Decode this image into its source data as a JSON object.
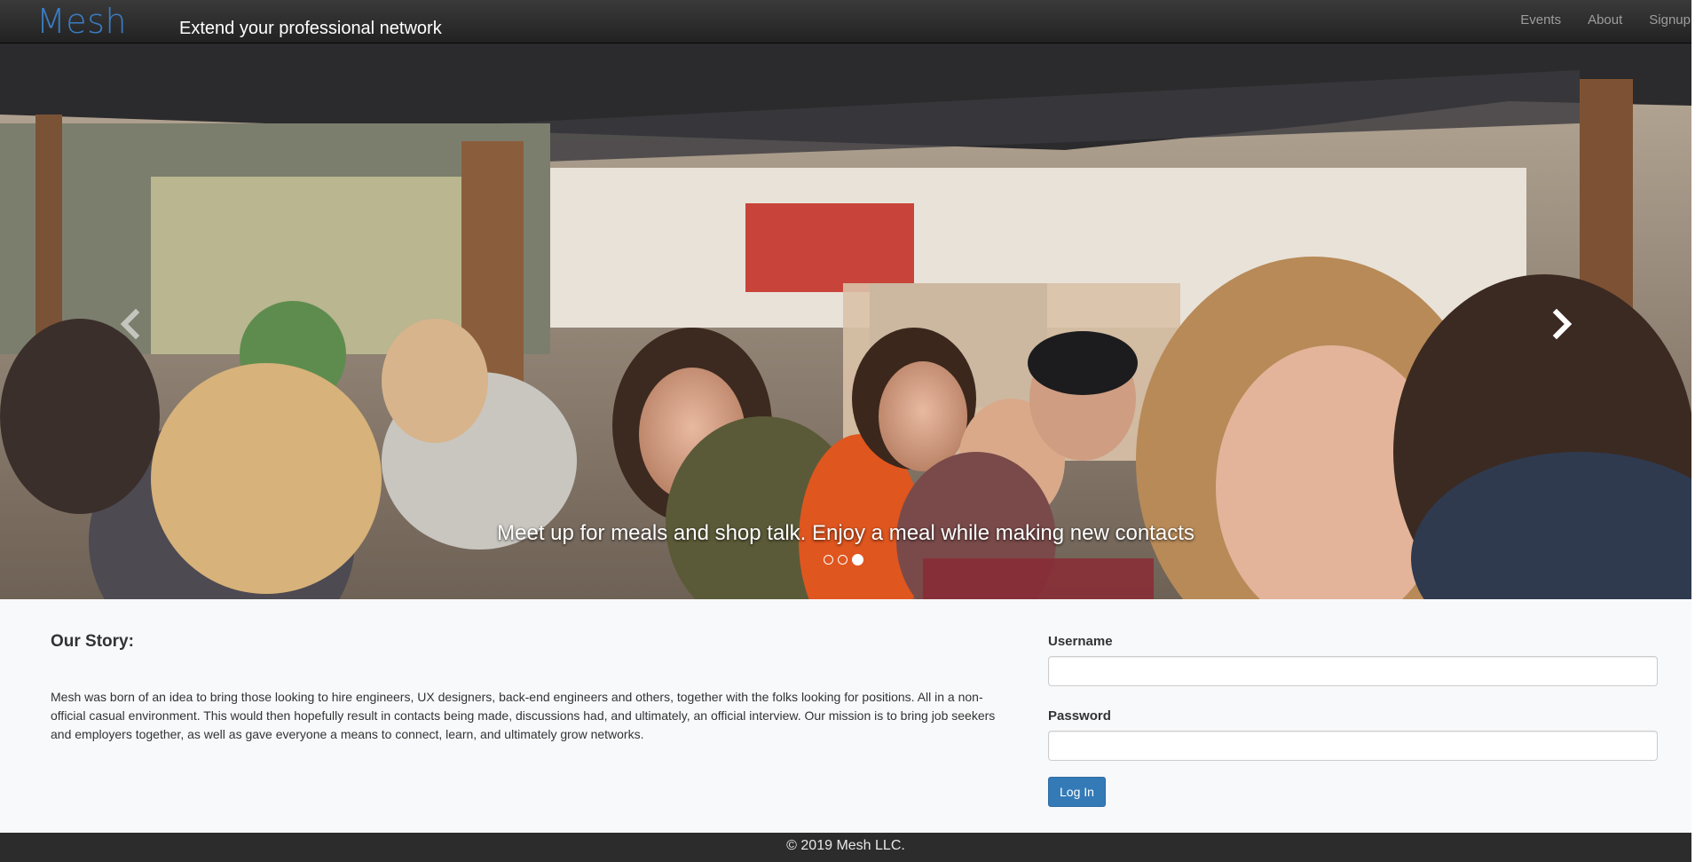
{
  "navbar": {
    "brand": "Mesh",
    "tagline": "Extend your professional network",
    "links": [
      "Events",
      "About",
      "Signup"
    ]
  },
  "carousel": {
    "caption": "Meet up for meals and shop talk. Enjoy a meal while making new contacts",
    "slide_count": 3,
    "active_slide": 3,
    "prev_icon": "chevron-left-icon",
    "next_icon": "chevron-right-icon"
  },
  "story": {
    "heading": "Our Story:",
    "text": "Mesh was born of an idea to bring those looking to hire engineers, UX designers, back-end engineers and others, together with the folks looking for positions. All in a non-official casual environment. This would then hopefully result in contacts being made, discussions had, and ultimately, an official interview. Our mission is to bring job seekers and employers together, as well as gave everyone a means to connect, learn, and ultimately grow networks."
  },
  "login": {
    "username_label": "Username",
    "username_value": "",
    "password_label": "Password",
    "password_value": "",
    "submit_label": "Log In"
  },
  "footer": {
    "text": "© 2019 Mesh LLC."
  },
  "colors": {
    "brand": "#3a7cc2",
    "primary_button": "#337ab7",
    "navbar": "#222222",
    "footer": "#2c2c2c"
  }
}
